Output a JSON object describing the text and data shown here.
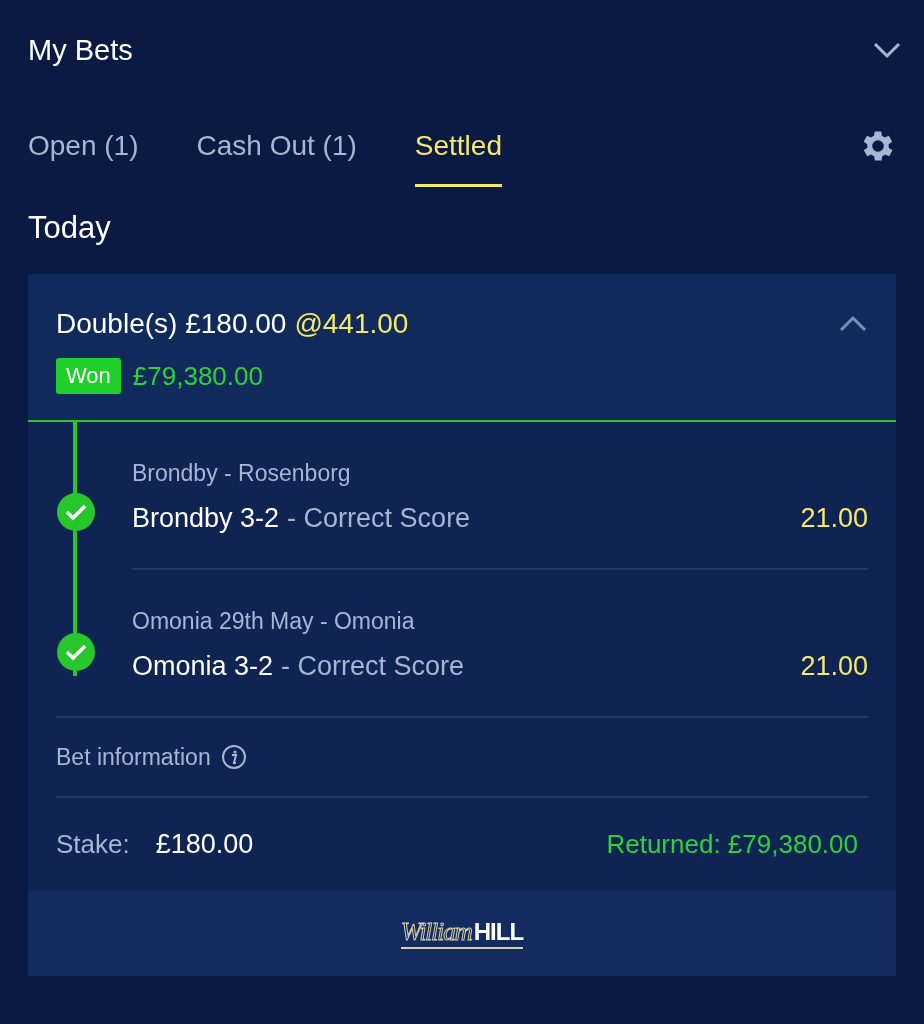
{
  "header": {
    "title": "My Bets"
  },
  "tabs": [
    {
      "label": "Open (1)",
      "selected": false
    },
    {
      "label": "Cash Out (1)",
      "selected": false
    },
    {
      "label": "Settled",
      "selected": true
    }
  ],
  "section_title": "Today",
  "bet": {
    "title": "Double(s) £180.00",
    "odds": "@441.00",
    "expanded": true,
    "status": "Won",
    "winnings": "£79,380.00",
    "selections": [
      {
        "event": "Brondby - Rosenborg",
        "pick": "Brondby 3-2",
        "market": "- Correct Score",
        "odds": "21.00",
        "won": true
      },
      {
        "event": "Omonia 29th May - Omonia",
        "pick": "Omonia 3-2",
        "market": "- Correct Score",
        "odds": "21.00",
        "won": true
      }
    ],
    "info_label": "Bet information",
    "stake_label": "Stake:",
    "stake": "£180.00",
    "returned": "Returned: £79,380.00"
  },
  "footer": {
    "logo_script": "William",
    "logo_bold": "HILL"
  }
}
